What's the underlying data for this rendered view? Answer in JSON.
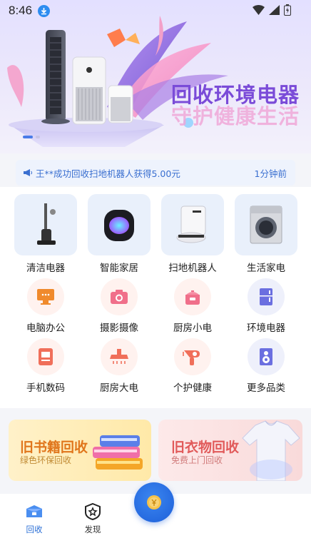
{
  "status_bar": {
    "time": "8:46"
  },
  "banner": {
    "title_line1": "回收环境电器",
    "title_line2": "守护健康生活"
  },
  "ticker": {
    "message": "王**成功回收扫地机器人获得5.00元",
    "time_ago": "1分钟前"
  },
  "categories_featured": [
    {
      "label": "清洁电器",
      "icon": "vacuum-cleaner-icon"
    },
    {
      "label": "智能家居",
      "icon": "smart-speaker-icon"
    },
    {
      "label": "扫地机器人",
      "icon": "robot-vacuum-icon"
    },
    {
      "label": "生活家电",
      "icon": "washing-machine-icon"
    }
  ],
  "categories_small": [
    {
      "label": "电脑办公",
      "icon": "monitor-icon",
      "color": "#f08a2c"
    },
    {
      "label": "摄影摄像",
      "icon": "camera-icon",
      "color": "#f06f8a"
    },
    {
      "label": "厨房小电",
      "icon": "rice-cooker-icon",
      "color": "#f06f8a"
    },
    {
      "label": "环境电器",
      "icon": "fridge-icon",
      "color": "#6b6fe0"
    },
    {
      "label": "手机数码",
      "icon": "phone-icon",
      "color": "#f06f5a"
    },
    {
      "label": "厨房大电",
      "icon": "range-hood-icon",
      "color": "#f06f5a"
    },
    {
      "label": "个护健康",
      "icon": "hair-dryer-icon",
      "color": "#f06f5a"
    },
    {
      "label": "更多品类",
      "icon": "speaker-icon",
      "color": "#6b6fe0"
    }
  ],
  "promos": {
    "books": {
      "title": "旧书籍回收",
      "subtitle": "绿色环保回收"
    },
    "clothes": {
      "title": "旧衣物回收",
      "subtitle": "免费上门回收"
    }
  },
  "tab_bar": {
    "recycle_label": "回收",
    "discover_label": "发现"
  },
  "colors": {
    "accent": "#2b6fd6",
    "banner_purple": "#7a4bd8"
  }
}
